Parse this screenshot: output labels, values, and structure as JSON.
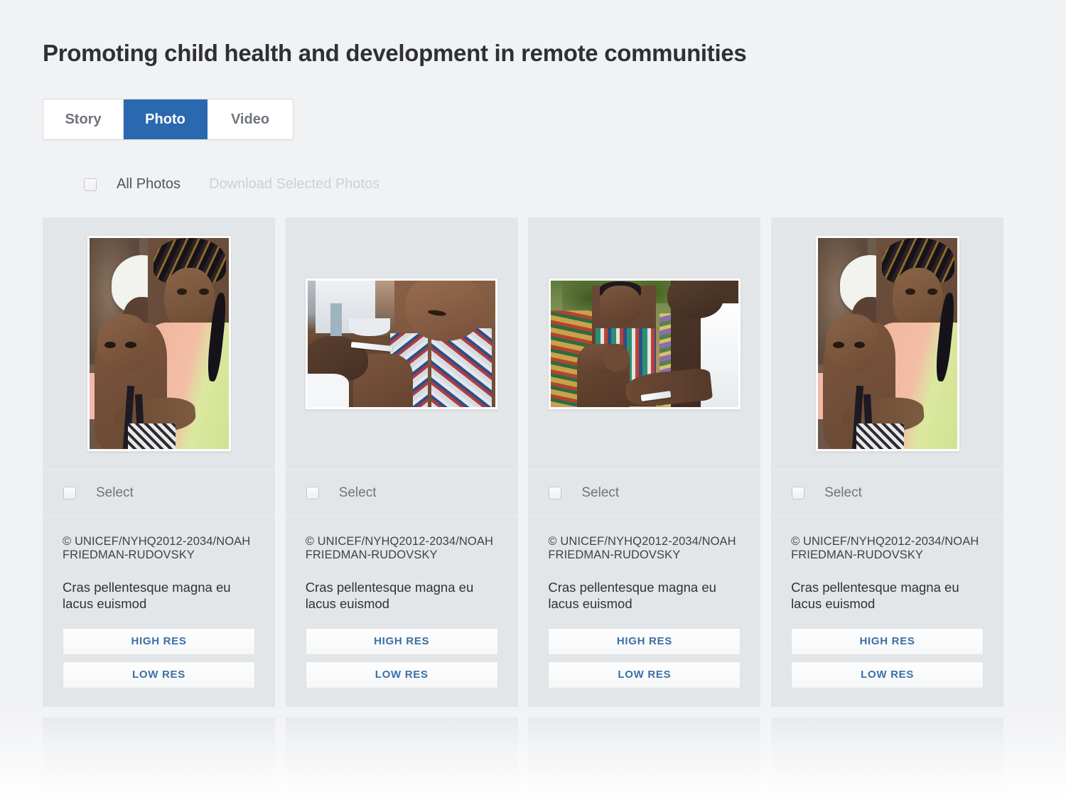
{
  "page": {
    "title": "Promoting child health and development in remote communities"
  },
  "tabs": [
    {
      "label": "Story",
      "active": false
    },
    {
      "label": "Photo",
      "active": true
    },
    {
      "label": "Video",
      "active": false
    }
  ],
  "toolbar": {
    "all_photos_label": "All Photos",
    "all_photos_checked": false,
    "download_action_label": "Download Selected Photos",
    "download_action_enabled": false
  },
  "colors": {
    "page_background": "#f1f2f4",
    "card_background": "#e3e6e9",
    "active_tab": "#2a68b0",
    "link_blue": "#3a6fa8",
    "title_text": "#2f3033",
    "muted_text": "#6f747c",
    "disabled_text": "#cdd0d5"
  },
  "cards": [
    {
      "select_label": "Select",
      "selected": false,
      "credit": "© UNICEF/NYHQ2012-2034/NOAH FRIEDMAN-RUDOVSKY",
      "caption": "Cras pellentesque magna eu lacus euismod",
      "high_res_label": "HIGH RES",
      "low_res_label": "LOW RES",
      "photo_alt": "Woman in pink and green tunic with patterned headwrap holding a baby, woman in white headwrap behind",
      "photo_orientation": "portrait"
    },
    {
      "select_label": "Select",
      "selected": false,
      "credit": "© UNICEF/NYHQ2012-2034/NOAH FRIEDMAN-RUDOVSKY",
      "caption": "Cras pellentesque magna eu lacus euismod",
      "high_res_label": "HIGH RES",
      "low_res_label": "LOW RES",
      "photo_alt": "Health worker's hands giving an injection to a young child in a patterned dress indoors",
      "photo_orientation": "landscape"
    },
    {
      "select_label": "Select",
      "selected": false,
      "credit": "© UNICEF/NYHQ2012-2034/NOAH FRIEDMAN-RUDOVSKY",
      "caption": "Cras pellentesque magna eu lacus euismod",
      "high_res_label": "HIGH RES",
      "low_res_label": "LOW RES",
      "photo_alt": "Outdoor vaccination: mother in striped shirt holding child while health worker in white coat administers injection, crowd behind",
      "photo_orientation": "landscape"
    },
    {
      "select_label": "Select",
      "selected": false,
      "credit": "© UNICEF/NYHQ2012-2034/NOAH FRIEDMAN-RUDOVSKY",
      "caption": "Cras pellentesque magna eu lacus euismod",
      "high_res_label": "HIGH RES",
      "low_res_label": "LOW RES",
      "photo_alt": "Woman in pink and green tunic with patterned headwrap holding a baby, woman in white headwrap behind",
      "photo_orientation": "portrait"
    }
  ]
}
